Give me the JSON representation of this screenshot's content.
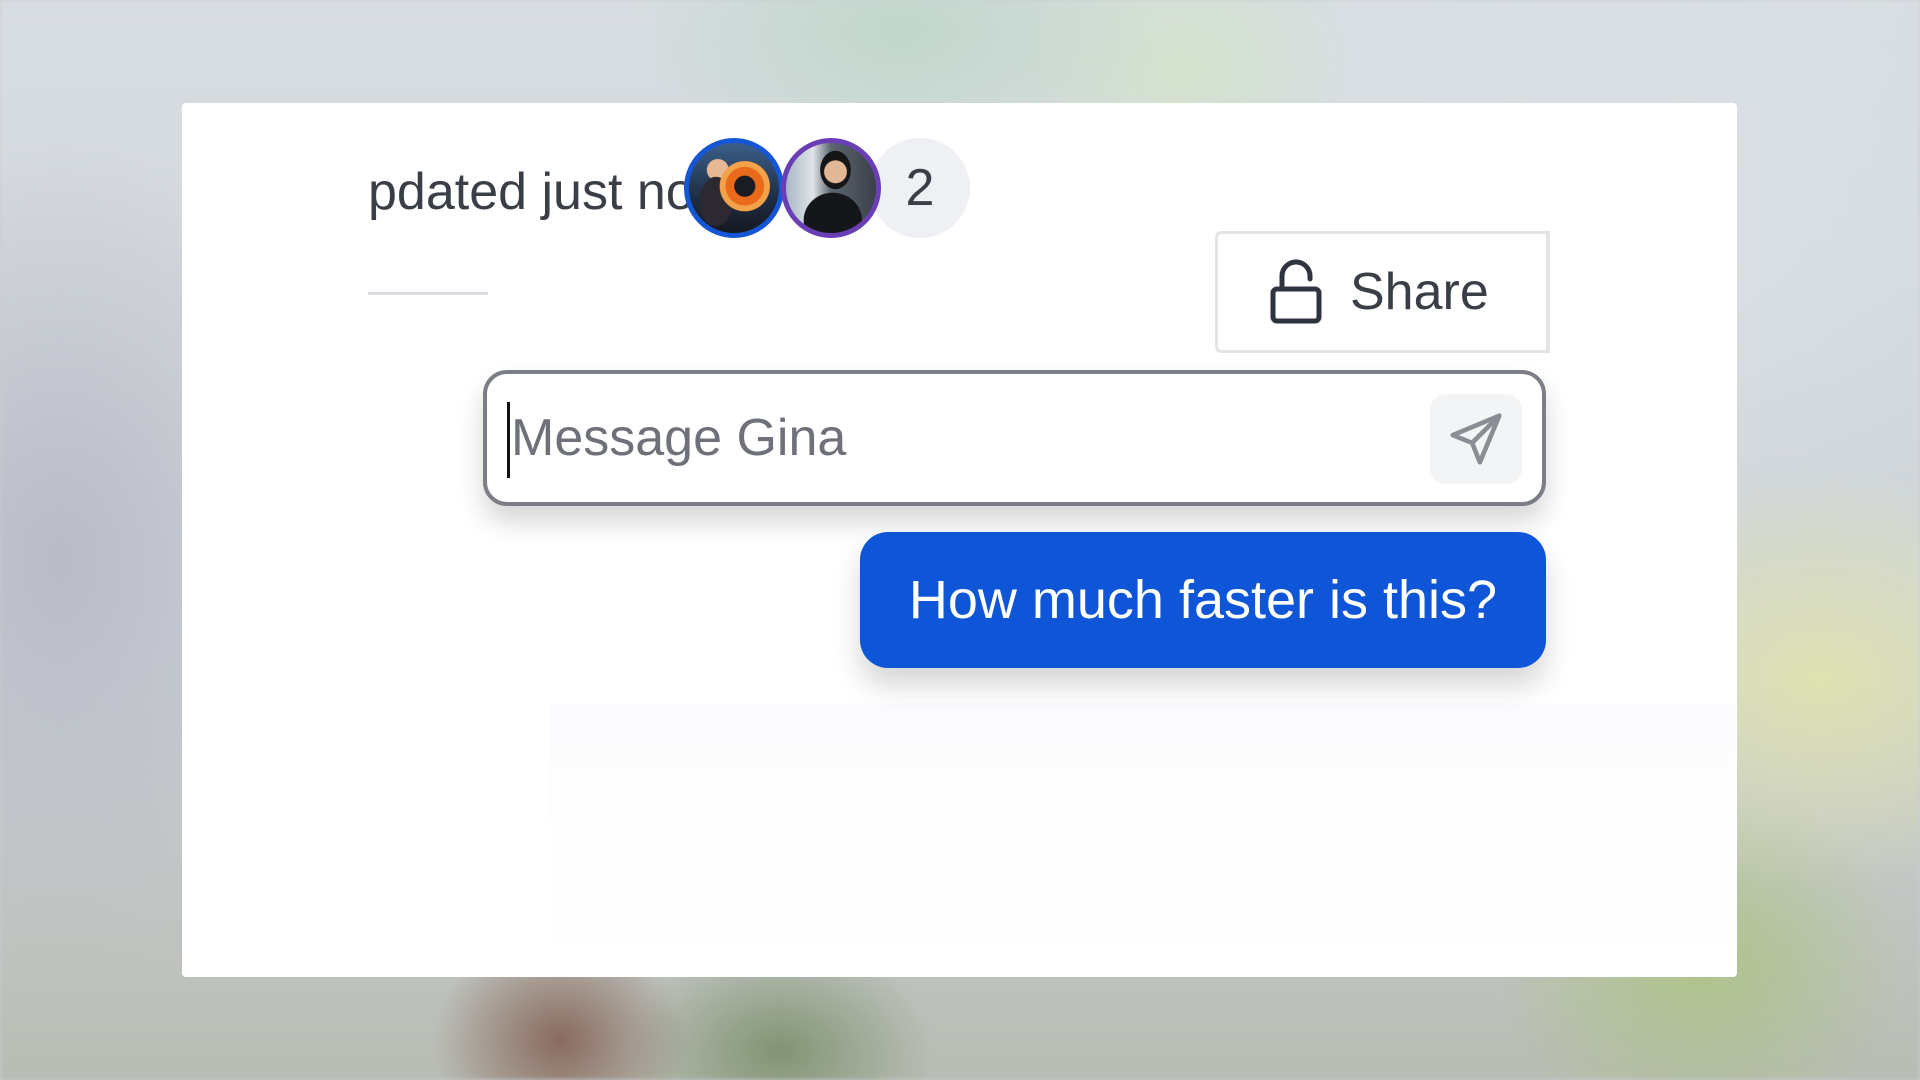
{
  "header": {
    "updated_text": "pdated just now",
    "collaborator_count": "2",
    "share_label": "Share"
  },
  "avatars": [
    {
      "name": "avatar-1",
      "ring_color": "#1556d6"
    },
    {
      "name": "avatar-2",
      "ring_color": "#6a3fb6"
    }
  ],
  "composer": {
    "placeholder": "Message Gina",
    "value": ""
  },
  "chat": {
    "sent_message": "How much faster is this?"
  },
  "colors": {
    "accent": "#0f55d8",
    "text": "#3a3f47",
    "border": "#7c7e87"
  },
  "icons": {
    "share": "unlock-icon",
    "send": "send-icon"
  }
}
